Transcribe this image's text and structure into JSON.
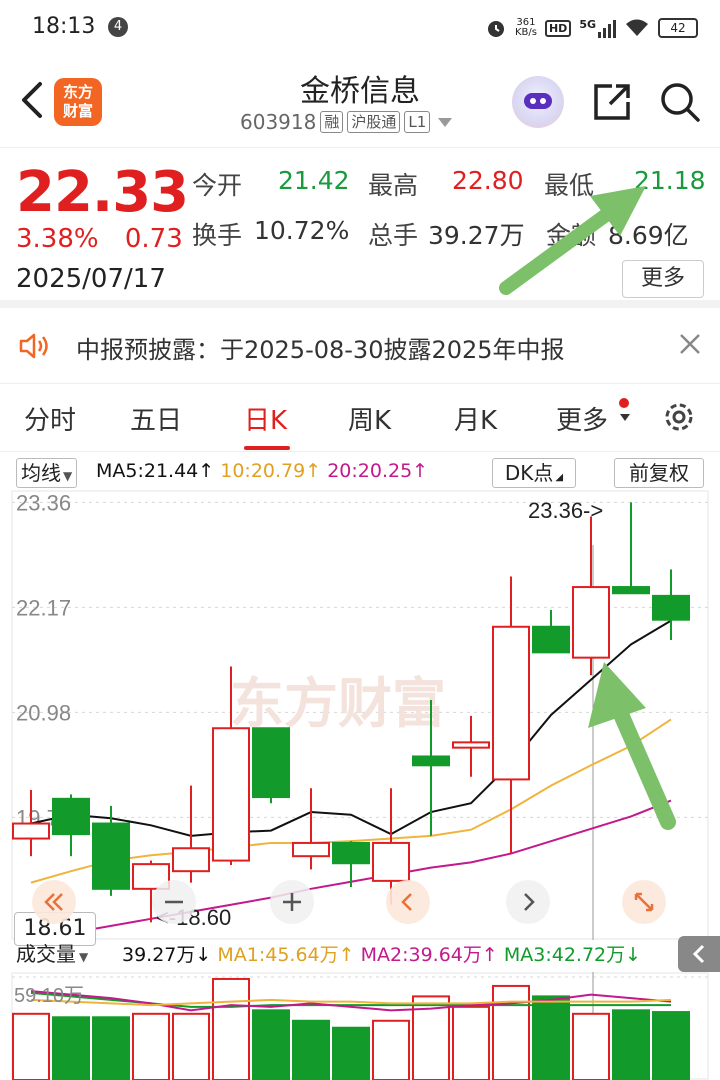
{
  "status_bar": {
    "time": "18:13",
    "notif_count": "4",
    "net_speed_value": "361",
    "net_speed_unit": "KB/s",
    "hd_label": "HD",
    "signal_label": "5G",
    "battery": "42"
  },
  "header": {
    "logo_text_line1": "东方",
    "logo_text_line2": "财富",
    "stock_name": "金桥信息",
    "stock_code": "603918",
    "tags": [
      "融",
      "沪股通",
      "L1"
    ]
  },
  "quote": {
    "price": "22.33",
    "change_pct": "3.38%",
    "change_amt": "0.73",
    "date": "2025/07/17",
    "open_label": "今开",
    "open_value": "21.42",
    "high_label": "最高",
    "high_value": "22.80",
    "low_label": "最低",
    "low_value": "21.18",
    "turnover_label": "换手",
    "turnover_value": "10.72%",
    "volume_label": "总手",
    "volume_value": "39.27万",
    "amount_label": "金额",
    "amount_value": "8.69亿",
    "more_label": "更多"
  },
  "notice": {
    "text": "中报预披露：于2025-08-30披露2025年中报"
  },
  "tabs": [
    {
      "label": "分时"
    },
    {
      "label": "五日"
    },
    {
      "label": "日K"
    },
    {
      "label": "周K"
    },
    {
      "label": "月K"
    },
    {
      "label": "更多"
    }
  ],
  "ma_bar": {
    "selector": "均线",
    "ma5": "MA5:21.44↑",
    "ma10": "10:20.79↑",
    "ma20": "20:20.25↑",
    "dk_label": "DK点",
    "adjust_label": "前复权"
  },
  "chart_labels": {
    "y_ticks": [
      "23.36",
      "22.17",
      "20.98",
      "19.79"
    ],
    "high_marker": "23.36->",
    "low_marker": "<-18.60",
    "crosshair_price": "18.61",
    "watermark": "东方财富"
  },
  "volume_bar": {
    "selector": "成交量",
    "vol": "39.27万↓",
    "ma1": "MA1:45.64万↑",
    "ma2": "MA2:39.64万↑",
    "ma3": "MA3:42.72万↓",
    "top_label": "59.10万"
  },
  "colors": {
    "up": "#e02020",
    "down": "#129a2a",
    "ma5": "#111111",
    "ma10": "#f0b43c",
    "ma20": "#c2198c",
    "brand": "#f26522",
    "arrow": "#7cc06a"
  },
  "chart_data": {
    "type": "candlestick",
    "series_order": [
      "open",
      "close",
      "high",
      "low"
    ],
    "candles": [
      {
        "o": 19.55,
        "c": 19.72,
        "h": 20.1,
        "l": 19.35
      },
      {
        "o": 20.0,
        "c": 19.6,
        "h": 20.05,
        "l": 19.35
      },
      {
        "o": 19.72,
        "c": 18.98,
        "h": 19.92,
        "l": 18.9
      },
      {
        "o": 18.98,
        "c": 19.26,
        "h": 19.3,
        "l": 18.6
      },
      {
        "o": 19.18,
        "c": 19.44,
        "h": 20.15,
        "l": 19.05
      },
      {
        "o": 19.3,
        "c": 20.8,
        "h": 21.5,
        "l": 19.25
      },
      {
        "o": 20.8,
        "c": 20.02,
        "h": 20.8,
        "l": 19.95
      },
      {
        "o": 19.35,
        "c": 19.5,
        "h": 20.12,
        "l": 19.2
      },
      {
        "o": 19.5,
        "c": 19.27,
        "h": 19.52,
        "l": 19.0
      },
      {
        "o": 19.07,
        "c": 19.5,
        "h": 20.12,
        "l": 18.8
      },
      {
        "o": 20.48,
        "c": 20.38,
        "h": 21.12,
        "l": 19.58
      },
      {
        "o": 20.58,
        "c": 20.64,
        "h": 20.94,
        "l": 20.25
      },
      {
        "o": 20.22,
        "c": 21.95,
        "h": 22.52,
        "l": 19.38
      },
      {
        "o": 21.95,
        "c": 21.66,
        "h": 22.14,
        "l": 21.66
      },
      {
        "o": 21.6,
        "c": 22.4,
        "h": 23.2,
        "l": 21.4
      },
      {
        "o": 22.4,
        "c": 22.33,
        "h": 23.36,
        "l": 22.33
      },
      {
        "o": 22.3,
        "c": 22.03,
        "h": 22.6,
        "l": 21.8
      }
    ],
    "ma5": [
      19.72,
      19.82,
      19.78,
      19.7,
      19.58,
      19.62,
      19.64,
      19.85,
      19.82,
      19.6,
      19.85,
      19.95,
      20.4,
      20.95,
      21.35,
      21.75,
      22.02
    ],
    "ma10": [
      19.05,
      19.18,
      19.3,
      19.36,
      19.4,
      19.45,
      19.5,
      19.5,
      19.52,
      19.55,
      19.58,
      19.65,
      19.88,
      20.15,
      20.38,
      20.6,
      20.9
    ],
    "ma20": [
      18.42,
      18.48,
      18.56,
      18.64,
      18.72,
      18.8,
      18.88,
      18.98,
      19.06,
      19.14,
      19.22,
      19.28,
      19.38,
      19.52,
      19.66,
      19.8,
      19.98
    ],
    "ylim": [
      18.4,
      23.5
    ],
    "y_ticks": [
      23.36,
      22.17,
      20.98,
      19.79
    ],
    "volume": {
      "values": [
        38,
        36,
        36,
        38,
        38,
        58,
        40,
        34,
        30,
        34,
        48,
        42,
        54,
        48,
        38,
        40,
        39
      ],
      "dir": [
        "up",
        "down",
        "down",
        "up",
        "up",
        "up",
        "down",
        "down",
        "down",
        "up",
        "up",
        "up",
        "up",
        "down",
        "up",
        "down",
        "down"
      ],
      "ma1": [
        46,
        45,
        44,
        43,
        44,
        45,
        46,
        45,
        45,
        44,
        44,
        44,
        45,
        45,
        45,
        45,
        46
      ],
      "ma2": [
        51,
        49,
        47,
        44,
        40,
        43,
        42,
        44,
        42,
        40,
        41,
        43,
        44,
        46,
        49,
        47,
        45
      ],
      "ma3": [
        50,
        48,
        46,
        44,
        42,
        42,
        43,
        43,
        43,
        43,
        43,
        43,
        43,
        43,
        43,
        43,
        43
      ],
      "ylim": [
        0,
        62
      ],
      "top_label": 59.1
    }
  }
}
